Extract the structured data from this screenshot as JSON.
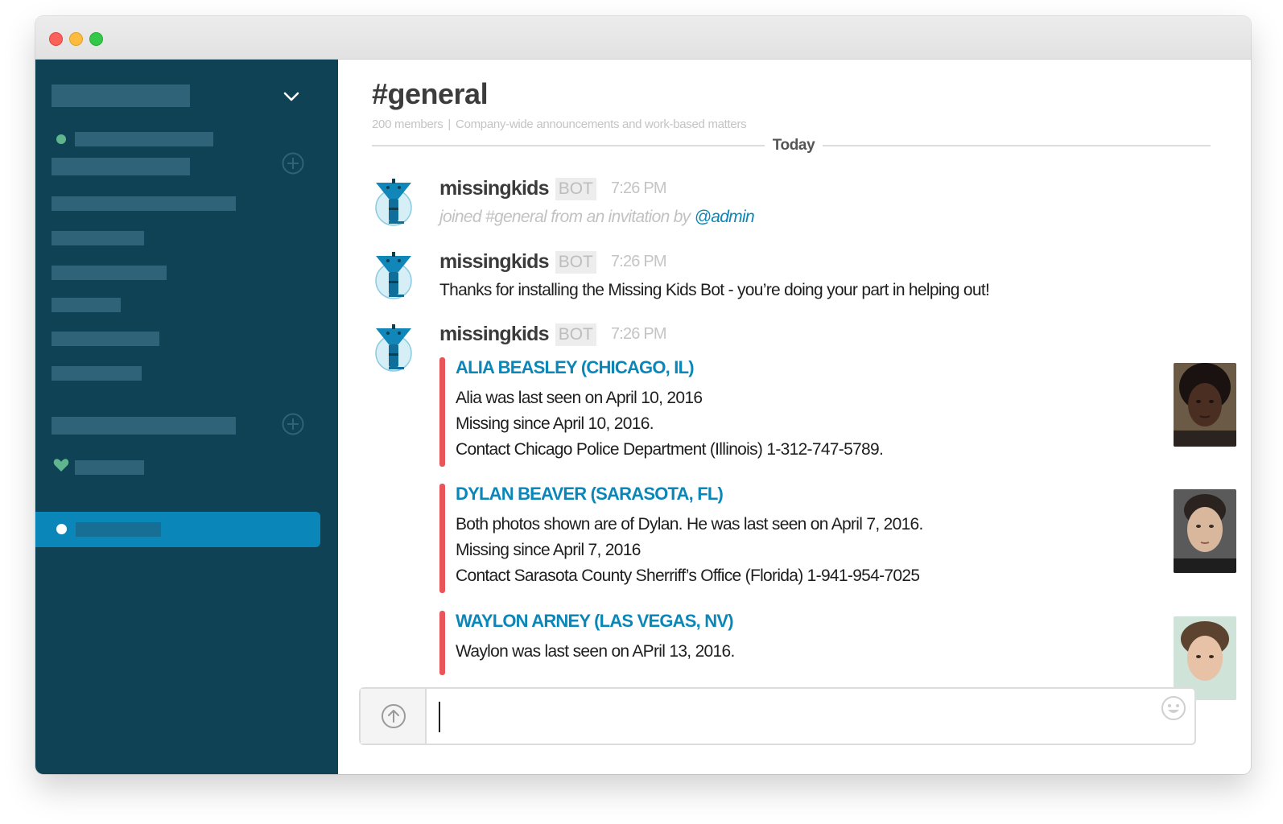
{
  "channel": {
    "title": "#general",
    "member_count": "200 members",
    "separator": "|",
    "purpose": "Company-wide announcements and work-based matters"
  },
  "divider": {
    "label": "Today"
  },
  "messages": [
    {
      "author": "missingkids",
      "badge": "BOT",
      "time": "7:26 PM",
      "text_prefix": "joined #general from an invitation by ",
      "mention": "@admin"
    },
    {
      "author": "missingkids",
      "badge": "BOT",
      "time": "7:26 PM",
      "text": "Thanks for installing the Missing Kids Bot - you’re doing your part in helping out!"
    },
    {
      "author": "missingkids",
      "badge": "BOT",
      "time": "7:26 PM"
    }
  ],
  "attachments": [
    {
      "title": "ALIA BEASLEY (CHICAGO, IL)",
      "lines": [
        "Alia was last seen on April 10, 2016",
        "Missing since April 10, 2016.",
        "Contact Chicago Police Department (Illinois) 1-312-747-5789."
      ],
      "photo_skin": "#4a2e22",
      "photo_hair": "#1a1210",
      "photo_bg": "#6b5a45"
    },
    {
      "title": "DYLAN BEAVER (SARASOTA, FL)",
      "lines": [
        "Both photos shown are of Dylan. He was last seen on April 7, 2016.",
        "Missing since April 7, 2016",
        "Contact Sarasota County Sherriff’s Office (Florida) 1-941-954-7025"
      ],
      "photo_skin": "#d8b79c",
      "photo_hair": "#2a2320",
      "photo_bg": "#5a5a5a"
    },
    {
      "title": "WAYLON ARNEY (LAS VEGAS, NV)",
      "lines": [
        "Waylon was last seen on APril 13, 2016."
      ],
      "photo_skin": "#e7c2a6",
      "photo_hair": "#5b4330",
      "photo_bg": "#cfe3d9"
    }
  ],
  "composer": {
    "value": "",
    "placeholder": ""
  },
  "colors": {
    "sidebar_bg": "#0f4254",
    "sidebar_active": "#0a87b8",
    "link": "#0a87b8",
    "attachment_bar": "#e8555a"
  },
  "icons": [
    "chevron-down-icon",
    "add-channel-icon",
    "heart-icon",
    "upload-icon",
    "emoji-icon",
    "missingkids-bot-avatar"
  ]
}
